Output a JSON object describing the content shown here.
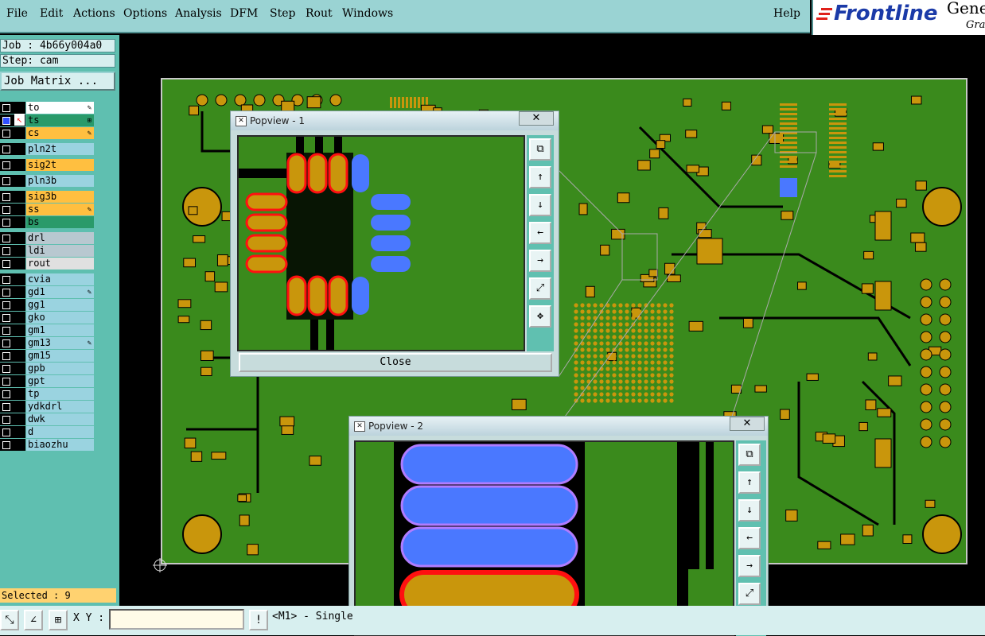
{
  "menubar": {
    "items": [
      {
        "label": "File"
      },
      {
        "label": "Edit"
      },
      {
        "label": "Actions"
      },
      {
        "label": "Options"
      },
      {
        "label": "Analysis"
      },
      {
        "label": "DFM"
      },
      {
        "label": "Step"
      },
      {
        "label": "Rout"
      },
      {
        "label": "Windows"
      }
    ],
    "help": "Help"
  },
  "logo": {
    "brand": "Frontline",
    "product": "Gene",
    "sub": "Grap"
  },
  "job": {
    "job_label": "Job : 4b66y004a0",
    "step_label": "Step: cam",
    "matrix_button": "Job Matrix ..."
  },
  "layers": [
    {
      "name": "to",
      "color": "#ffffff",
      "mark": "✎"
    },
    {
      "name": "ts",
      "color": "#2a9a6a",
      "mark": "⊞",
      "active": true
    },
    {
      "name": "cs",
      "color": "#ffbf40",
      "mark": "✎"
    },
    {
      "name": "pln2t",
      "color": "#9ad3e0",
      "mark": ""
    },
    {
      "name": "sig2t",
      "color": "#ffbf40",
      "mark": ""
    },
    {
      "name": "pln3b",
      "color": "#9ad3e0",
      "mark": ""
    },
    {
      "name": "sig3b",
      "color": "#ffbf40",
      "mark": ""
    },
    {
      "name": "ss",
      "color": "#ffbf40",
      "mark": "✎"
    },
    {
      "name": "bs",
      "color": "#2a9a6a",
      "mark": ""
    },
    {
      "name": "drl",
      "color": "#b8c8d0",
      "mark": ""
    },
    {
      "name": "ldi",
      "color": "#b8c8d0",
      "mark": ""
    },
    {
      "name": "rout",
      "color": "#e0e0e0",
      "mark": ""
    },
    {
      "name": "cvia",
      "color": "#9ad3e0",
      "mark": ""
    },
    {
      "name": "gd1",
      "color": "#9ad3e0",
      "mark": "✎"
    },
    {
      "name": "gg1",
      "color": "#9ad3e0",
      "mark": ""
    },
    {
      "name": "gko",
      "color": "#9ad3e0",
      "mark": ""
    },
    {
      "name": "gm1",
      "color": "#9ad3e0",
      "mark": ""
    },
    {
      "name": "gm13",
      "color": "#9ad3e0",
      "mark": "✎"
    },
    {
      "name": "gm15",
      "color": "#9ad3e0",
      "mark": ""
    },
    {
      "name": "gpb",
      "color": "#9ad3e0",
      "mark": ""
    },
    {
      "name": "gpt",
      "color": "#9ad3e0",
      "mark": ""
    },
    {
      "name": "tp",
      "color": "#9ad3e0",
      "mark": ""
    },
    {
      "name": "ydkdrl",
      "color": "#9ad3e0",
      "mark": ""
    },
    {
      "name": "dwk",
      "color": "#9ad3e0",
      "mark": ""
    },
    {
      "name": "d",
      "color": "#9ad3e0",
      "mark": ""
    },
    {
      "name": "biaozhu",
      "color": "#9ad3e0",
      "mark": ""
    }
  ],
  "selected": "Selected : 9",
  "toolbar": {
    "xy_label": "X Y :",
    "xy_value": "",
    "warn": "!",
    "status": "<M1> - Single"
  },
  "popview1": {
    "title": "Popview - 1",
    "close_x": "✕",
    "close_button": "Close"
  },
  "popview2": {
    "title": "Popview - 2",
    "close_x": "✕"
  },
  "colors": {
    "board": "#3a8a1c",
    "pad": "#c9960c",
    "highlight": "#4a78ff",
    "outline": "#ff1010",
    "menu": "#9ad3d3"
  }
}
